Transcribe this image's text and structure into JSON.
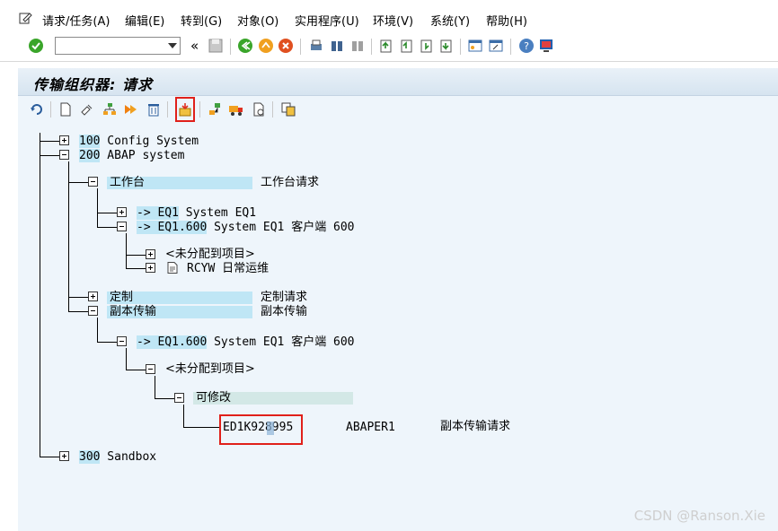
{
  "menubar": {
    "items": [
      "请求/任务(A)",
      "编辑(E)",
      "转到(G)",
      "对象(O)",
      "实用程序(U)",
      "环境(V)",
      "系统(Y)",
      "帮助(H)"
    ]
  },
  "stdbar": {
    "command_value": "",
    "icons": [
      "enter-icon",
      "save-icon",
      "back-icon",
      "exit-icon",
      "cancel-icon",
      "print-icon",
      "find-icon",
      "find-next-icon",
      "first-page-icon",
      "prev-page-icon",
      "next-page-icon",
      "last-page-icon",
      "new-session-icon",
      "shortcut-icon",
      "help-icon",
      "layout-icon"
    ]
  },
  "screen": {
    "title": "传输组织器: 请求"
  },
  "tree": {
    "n100": {
      "num": "100",
      "text": " Config System"
    },
    "n200": {
      "num": "200",
      "text": " ABAP system"
    },
    "workbench": {
      "label": "工作台",
      "desc": "工作台请求"
    },
    "eq1": {
      "label": "-> EQ1",
      "text": " System EQ1"
    },
    "eq1_600": {
      "label": "-> EQ1.600",
      "text": " System EQ1 客户端 600"
    },
    "unassigned": {
      "text": "<未分配到项目>"
    },
    "rcyw": {
      "text": "RCYW 日常运维"
    },
    "custom": {
      "label": "定制",
      "desc": "定制请求"
    },
    "copy": {
      "label": "副本传输",
      "desc": "副本传输"
    },
    "copy_eq1_600": {
      "label": "-> EQ1.600",
      "text": " System EQ1 客户端 600"
    },
    "copy_unassigned": {
      "text": "<未分配到项目>"
    },
    "modifiable": {
      "label": "可修改"
    },
    "request": {
      "id": "ED1K928995",
      "owner": "ABAPER1",
      "desc": "副本传输请求"
    },
    "n300": {
      "num": "300",
      "text": " Sandbox"
    }
  },
  "watermark": "CSDN @Ranson.Xie",
  "colors": {
    "highlight": "#bfe6f5",
    "annotation_box": "#e0201a",
    "screen_bg": "#eef5fb"
  }
}
